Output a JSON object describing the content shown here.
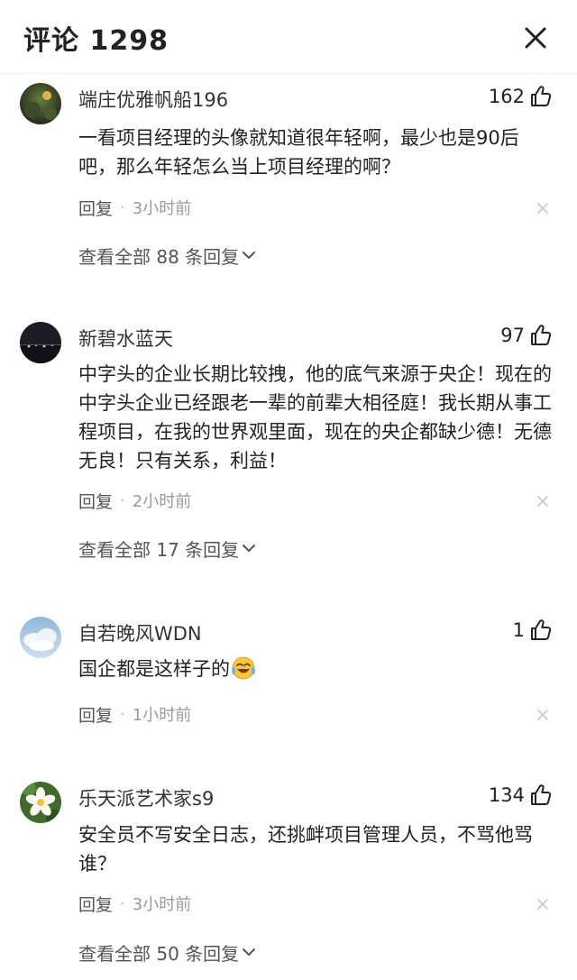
{
  "header": {
    "title": "评论 1298",
    "close_icon": "close-icon"
  },
  "comments": [
    {
      "username": "端庄优雅帆船196",
      "likes": "162",
      "text": "一看项目经理的头像就知道很年轻啊，最少也是90后吧，那么年轻怎么当上项目经理的啊？",
      "reply_label": "回复",
      "separator": "·",
      "time": "3小时前",
      "view_all_label": "查看全部 88 条回复"
    },
    {
      "username": "新碧水蓝天",
      "likes": "97",
      "text": "中字头的企业长期比较拽，他的底气来源于央企！现在的中字头企业已经跟老一辈的前辈大相径庭！我长期从事工程项目，在我的世界观里面，现在的央企都缺少德！无德无良！只有关系，利益！",
      "reply_label": "回复",
      "separator": "·",
      "time": "2小时前",
      "view_all_label": "查看全部 17 条回复"
    },
    {
      "username": "自若晚风WDN",
      "likes": "1",
      "text": "国企都是这样子的",
      "emoji": "crying-laughing-emoji",
      "reply_label": "回复",
      "separator": "·",
      "time": "1小时前"
    },
    {
      "username": "乐天派艺术家s9",
      "likes": "134",
      "text": "安全员不写安全日志，还挑衅项目管理人员，不骂他骂谁？",
      "reply_label": "回复",
      "separator": "·",
      "time": "3小时前",
      "view_all_label": "查看全部 50 条回复"
    }
  ],
  "icons": {
    "like": "thumbs-up-icon",
    "dismiss": "close-icon",
    "expand": "chevron-down-icon"
  },
  "colors": {
    "text_primary": "#222222",
    "text_secondary": "#999999",
    "divider": "#eeeeee"
  }
}
